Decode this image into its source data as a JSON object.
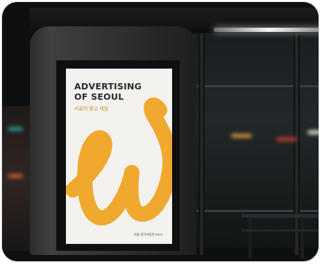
{
  "poster": {
    "title_line1": "ADVERTISING",
    "title_line2": "OF SEOUL",
    "subtitle": "서울의 광고 게임",
    "footer": "서울 광고박람회 2024",
    "script_letter": "w"
  },
  "colors": {
    "poster_bg": "#f3f2ef",
    "script_orange": "#f0a92e",
    "title_text": "#2a2a2a",
    "night_bg": "#0d0f10"
  }
}
